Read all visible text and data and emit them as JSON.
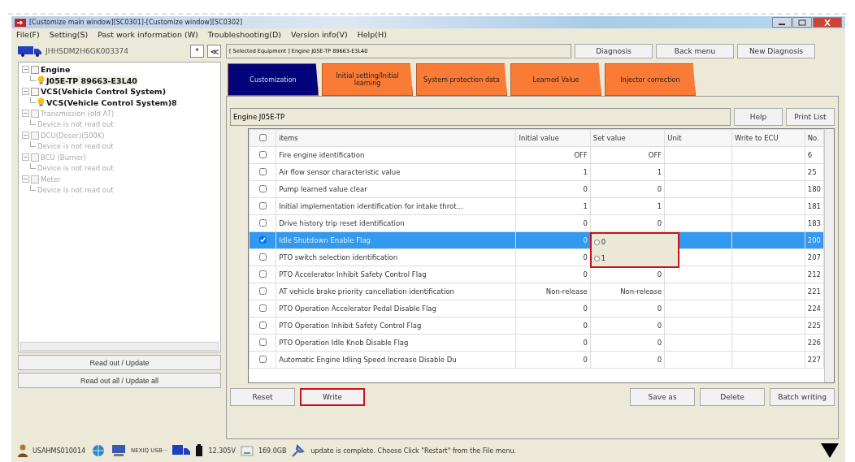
{
  "window": {
    "title": "[Customize main window][SC0301]-[Customize window][SC0302]"
  },
  "menu": [
    "File(F)",
    "Setting(S)",
    "Past work information (W)",
    "Troubleshooting(D)",
    "Version info(V)",
    "Help(H)"
  ],
  "sidebar": {
    "vin": "JHHSDM2H6GK003374",
    "small_button": "*",
    "collapse_button": "≪",
    "tree": [
      {
        "label": "Engine",
        "disabled": false,
        "children": [
          {
            "label": "J05E-TP 89663-E3L40",
            "disabled": false,
            "selected": true,
            "kind": "ecu"
          }
        ]
      },
      {
        "label": "VCS(Vehicle Control System)",
        "disabled": false,
        "children": [
          {
            "label": "VCS(Vehicle Control System)8",
            "disabled": false,
            "selected": false,
            "kind": "ecu"
          }
        ]
      },
      {
        "label": "Transmission (old AT)",
        "disabled": true,
        "children": [
          {
            "label": "Device is not read out",
            "disabled": true,
            "selected": false,
            "kind": "note"
          }
        ]
      },
      {
        "label": "DCU(Doser)(500K)",
        "disabled": true,
        "children": [
          {
            "label": "Device is not read out",
            "disabled": true,
            "selected": false,
            "kind": "note"
          }
        ]
      },
      {
        "label": "BCU (Burner)",
        "disabled": true,
        "children": [
          {
            "label": "Device is not read out",
            "disabled": true,
            "selected": false,
            "kind": "note"
          }
        ]
      },
      {
        "label": "Meter",
        "disabled": true,
        "children": [
          {
            "label": "Device is not read out",
            "disabled": true,
            "selected": false,
            "kind": "note"
          }
        ]
      }
    ],
    "buttons": [
      "Read out / Update",
      "Read out all / Update all"
    ]
  },
  "selected_equipment": "[ Selected Equipment ] Engine J05E-TP 89663-E3L40",
  "top_buttons": [
    "Diagnosis",
    "Back menu",
    "New Diagnosis"
  ],
  "tabs": [
    {
      "label": "Customization",
      "selected": true
    },
    {
      "label": "Initial setting/Initial learning",
      "selected": false
    },
    {
      "label": "System protection data",
      "selected": false
    },
    {
      "label": "Learned Value",
      "selected": false
    },
    {
      "label": "Injector correction",
      "selected": false
    }
  ],
  "ecu_field": "Engine J05E-TP",
  "panel_buttons": [
    "Help",
    "Print List"
  ],
  "table": {
    "columns": [
      "items",
      "Initial value",
      "Set value",
      "Unit",
      "Write to ECU",
      "No."
    ],
    "header_checked": false,
    "rows": [
      {
        "checked": false,
        "selected": false,
        "item": "Fire engine identification",
        "initial": "OFF",
        "set": "OFF",
        "no": "6"
      },
      {
        "checked": false,
        "selected": false,
        "item": "Air flow sensor characteristic value",
        "initial": "1",
        "set": "1",
        "no": "25"
      },
      {
        "checked": false,
        "selected": false,
        "item": "Pump learned value clear",
        "initial": "0",
        "set": "0",
        "no": "180"
      },
      {
        "checked": false,
        "selected": false,
        "item": "Initial implementation identification for intake throt…",
        "initial": "1",
        "set": "1",
        "no": "181"
      },
      {
        "checked": false,
        "selected": false,
        "item": "Drive history trip reset identification",
        "initial": "0",
        "set": "0",
        "no": "183"
      },
      {
        "checked": true,
        "selected": true,
        "item": "Idle Shutdown Enable Flag",
        "initial": "0",
        "no": "200",
        "dropdown": {
          "highlighted": true,
          "options": [
            {
              "label": "0",
              "selected": false
            },
            {
              "label": "1",
              "selected": false
            }
          ]
        }
      },
      {
        "checked": false,
        "selected": false,
        "item": "PTO switch selection identification",
        "initial": "0",
        "no": "207"
      },
      {
        "checked": false,
        "selected": false,
        "item": "PTO Accelerator Inhibit Safety Control Flag",
        "initial": "0",
        "set": "0",
        "no": "212"
      },
      {
        "checked": false,
        "selected": false,
        "item": "AT vehicle brake priority cancellation identification",
        "initial": "Non-release",
        "set": "Non-release",
        "no": "221"
      },
      {
        "checked": false,
        "selected": false,
        "item": "PTO Operation Accelerator Pedal Disable Flag",
        "initial": "0",
        "set": "0",
        "no": "224"
      },
      {
        "checked": false,
        "selected": false,
        "item": "PTO Operation Inhibit Safety Control Flag",
        "initial": "0",
        "set": "0",
        "no": "225"
      },
      {
        "checked": false,
        "selected": false,
        "item": "PTO Operation Idle Knob Disable Flag",
        "initial": "0",
        "set": "0",
        "no": "226"
      },
      {
        "checked": false,
        "selected": false,
        "item": "Automatic Engine Idling Speed Increase Disable Du",
        "initial": "0",
        "set": "0",
        "no": "227"
      }
    ]
  },
  "left_buttons": [
    {
      "label": "Reset",
      "highlighted": false
    },
    {
      "label": "Write",
      "highlighted": true
    }
  ],
  "right_buttons": [
    {
      "label": "Save as",
      "highlighted": false
    },
    {
      "label": "Delete",
      "highlighted": false
    },
    {
      "label": "Batch writing",
      "highlighted": false
    }
  ],
  "status_bar": {
    "user": "USAHMS010014",
    "device": "NEXIQ USB···",
    "voltage": "12.305V",
    "disk": "169.0GB",
    "message": "update is complete. Choose Click \"Restart\" from the File menu."
  }
}
